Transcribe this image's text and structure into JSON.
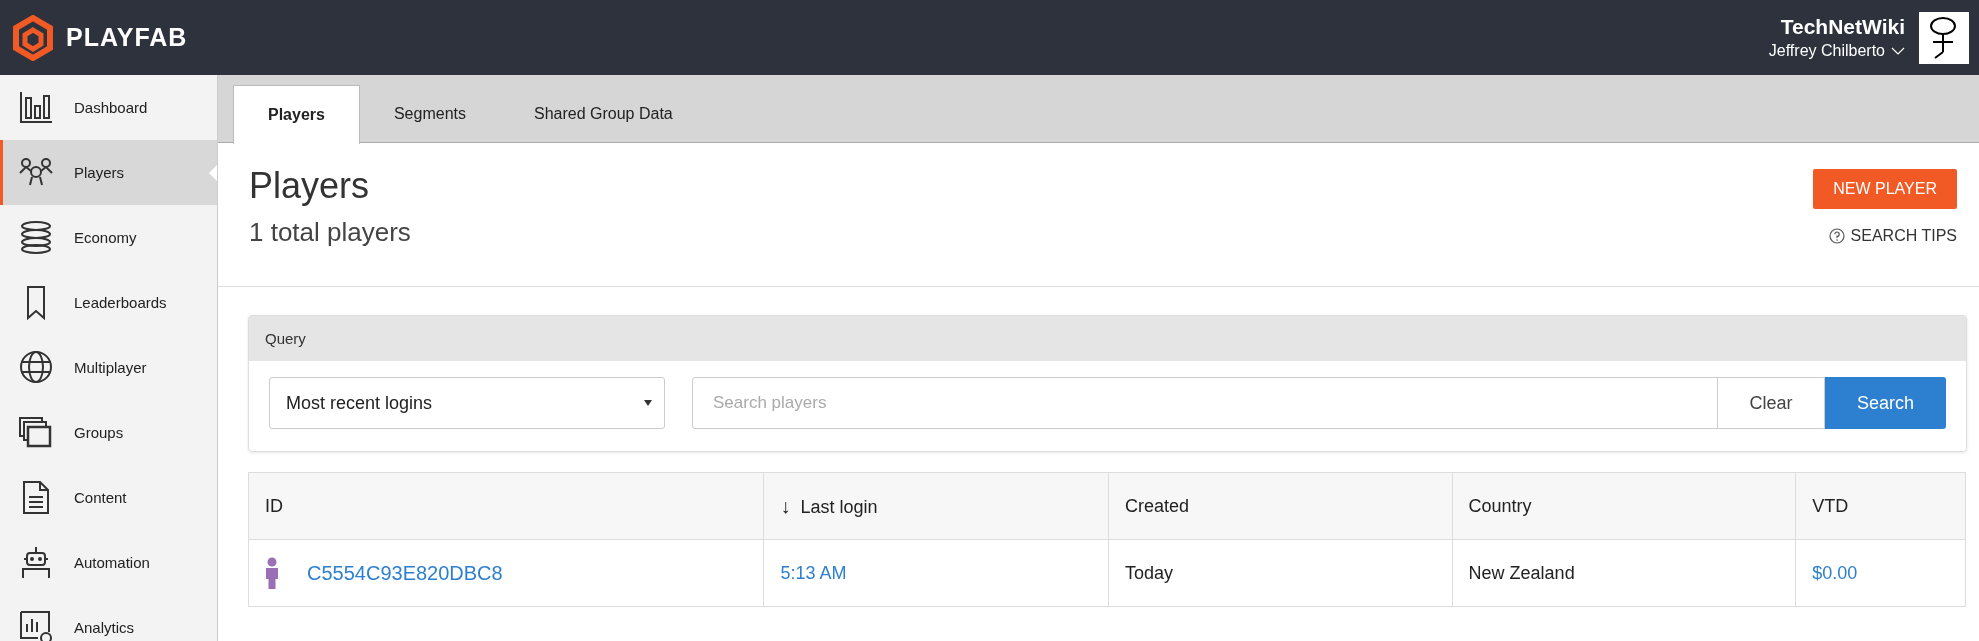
{
  "header": {
    "logo_text": "PLAYFAB",
    "studio": "TechNetWiki",
    "user": "Jeffrey Chilberto"
  },
  "sidebar": {
    "items": [
      {
        "label": "Dashboard",
        "selected": false
      },
      {
        "label": "Players",
        "selected": true
      },
      {
        "label": "Economy",
        "selected": false
      },
      {
        "label": "Leaderboards",
        "selected": false
      },
      {
        "label": "Multiplayer",
        "selected": false
      },
      {
        "label": "Groups",
        "selected": false
      },
      {
        "label": "Content",
        "selected": false
      },
      {
        "label": "Automation",
        "selected": false
      },
      {
        "label": "Analytics",
        "selected": false
      }
    ]
  },
  "tabs": [
    {
      "label": "Players",
      "selected": true
    },
    {
      "label": "Segments",
      "selected": false
    },
    {
      "label": "Shared Group Data",
      "selected": false
    }
  ],
  "page": {
    "title": "Players",
    "subtitle": "1 total players",
    "new_button": "NEW PLAYER",
    "search_tips": "SEARCH TIPS"
  },
  "query": {
    "title": "Query",
    "select_value": "Most recent logins",
    "search": {
      "placeholder": "Search players"
    },
    "clear_button": "Clear",
    "search_button": "Search"
  },
  "table": {
    "columns": [
      {
        "label": "ID"
      },
      {
        "label": "Last login",
        "sort_arrow": "↓"
      },
      {
        "label": "Created"
      },
      {
        "label": "Country"
      },
      {
        "label": "VTD"
      }
    ],
    "rows": [
      {
        "id": "C5554C93E820DBC8",
        "last_login": "5:13 AM",
        "created": "Today",
        "country": "New Zealand",
        "vtd": "$0.00"
      }
    ]
  }
}
